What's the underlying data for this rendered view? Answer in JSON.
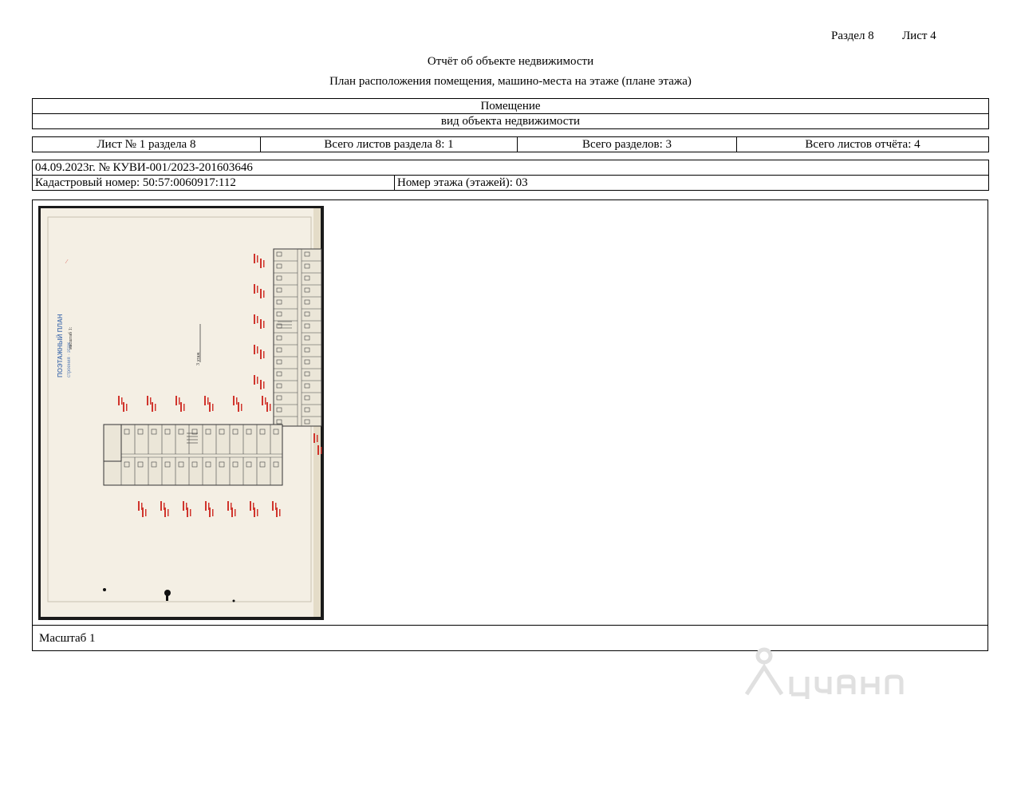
{
  "header": {
    "section": "Раздел 8",
    "sheet": "Лист 4"
  },
  "title": "Отчёт об объекте недвижимости",
  "subtitle": "План расположения помещения, машино-места на этаже (плане этажа)",
  "object": {
    "type_value": "Помещение",
    "type_caption": "вид объекта недвижимости"
  },
  "counts": {
    "sheet_of_section": "Лист № 1 раздела 8",
    "total_section_sheets": "Всего листов раздела 8: 1",
    "total_sections": "Всего разделов: 3",
    "total_report_sheets": "Всего листов отчёта: 4"
  },
  "document": {
    "date_number": "04.09.2023г. № КУВИ-001/2023-201603646",
    "cadastral_number": "Кадастровый номер: 50:57:0060917:112",
    "floor_number": "Номер этажа (этажей): 03"
  },
  "plan": {
    "floor_annotation": "3 этаж",
    "scale": "Масштаб 1"
  },
  "colors": {
    "ink": "#000000",
    "paper": "#f4efe4",
    "plan_lines": "#3a3a3a",
    "red_notes": "#d0342c",
    "blue_stamp": "#5b7fb5",
    "watermark": "#d0d0d0"
  }
}
